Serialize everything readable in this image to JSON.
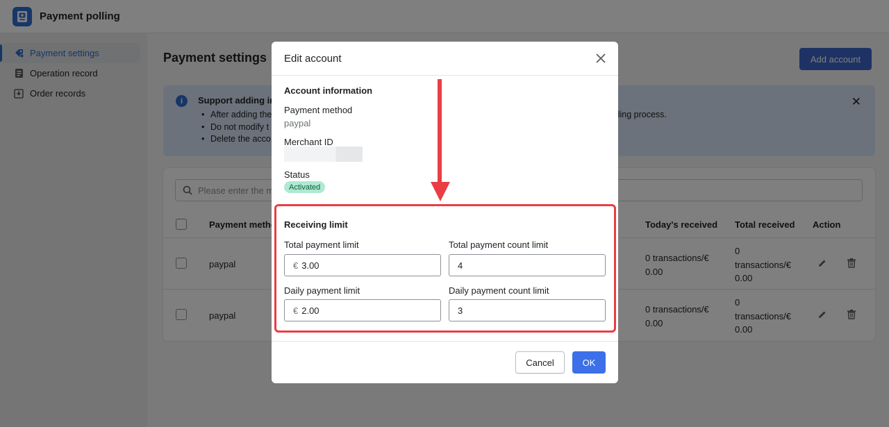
{
  "app": {
    "title": "Payment polling"
  },
  "sidebar": {
    "items": [
      {
        "label": "Payment settings",
        "icon": "payment-settings-icon",
        "active": true
      },
      {
        "label": "Operation record",
        "icon": "document-icon",
        "active": false
      },
      {
        "label": "Order records",
        "icon": "download-box-icon",
        "active": false
      }
    ]
  },
  "main": {
    "title": "Payment settings",
    "add_button": "Add account",
    "banner": {
      "title": "Support adding in",
      "bullets": [
        "After adding the",
        "Do not modify t",
        "Delete the acco"
      ],
      "bullet1_tail": "olling process."
    },
    "search_placeholder": "Please enter the m",
    "table": {
      "headers": {
        "method": "Payment metho",
        "today": "Today's received",
        "total": "Total received",
        "action": "Action"
      },
      "rows": [
        {
          "method": "paypal",
          "today_line1": "0 transactions/€",
          "today_line2": "0.00",
          "total_line1": "0",
          "total_line2": "transactions/€",
          "total_line3": "0.00"
        },
        {
          "method": "paypal",
          "today_line1": "0 transactions/€",
          "today_line2": "0.00",
          "total_line1": "0",
          "total_line2": "transactions/€",
          "total_line3": "0.00"
        }
      ]
    }
  },
  "modal": {
    "title": "Edit account",
    "account_section": "Account information",
    "payment_method_label": "Payment method",
    "payment_method_value": "paypal",
    "merchant_id_label": "Merchant ID",
    "status_label": "Status",
    "status_value": "Activated",
    "limit_section": "Receiving limit",
    "total_limit_label": "Total payment limit",
    "total_limit_currency": "€",
    "total_limit_value": "3.00",
    "total_count_label": "Total payment count limit",
    "total_count_value": "4",
    "daily_limit_label": "Daily payment limit",
    "daily_limit_currency": "€",
    "daily_limit_value": "2.00",
    "daily_count_label": "Daily payment count limit",
    "daily_count_value": "3",
    "cancel_label": "Cancel",
    "ok_label": "OK"
  },
  "colors": {
    "accent": "#3c6fe8",
    "highlight_box": "#ea3d44",
    "status_badge": "#aee9d1"
  }
}
